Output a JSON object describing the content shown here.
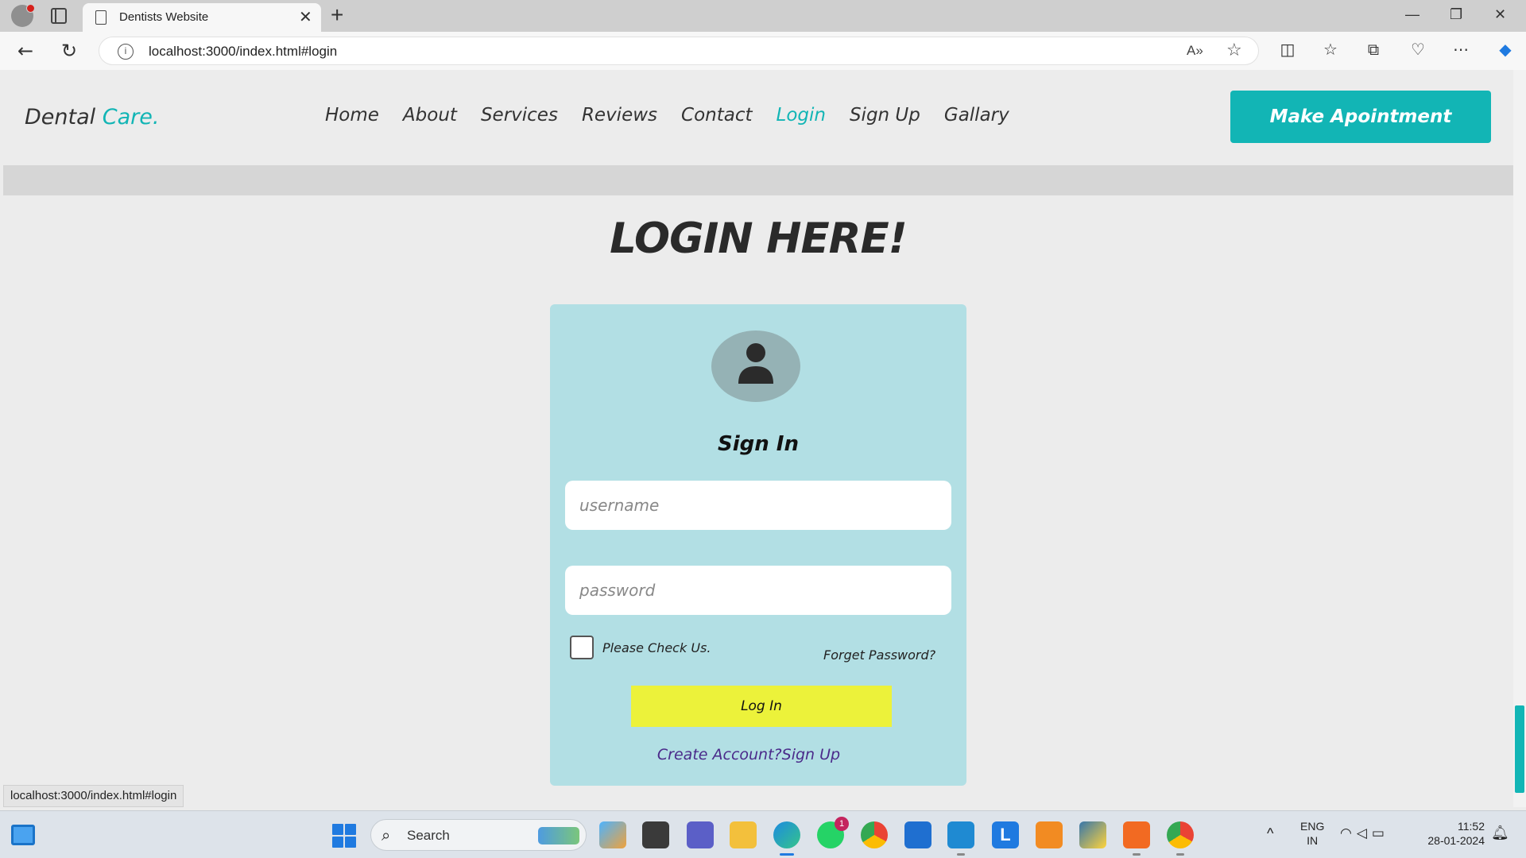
{
  "browser": {
    "tab_title": "Dentists Website",
    "tab_close": "✕",
    "new_tab": "+",
    "url": "localhost:3000/index.html#login",
    "window_controls": [
      "—",
      "❐",
      "✕"
    ],
    "status_url": "localhost:3000/index.html#login",
    "icons": [
      "back-icon",
      "refresh-icon",
      "info-icon",
      "read-aloud-icon",
      "favorite-icon",
      "split-screen-icon",
      "favorites-icon",
      "collections-icon",
      "browser-essentials-icon",
      "more-icon",
      "copilot-icon"
    ]
  },
  "site": {
    "logo": {
      "main": "Dental",
      "accent": "Care."
    },
    "nav": [
      {
        "label": "Home"
      },
      {
        "label": "About"
      },
      {
        "label": "Services"
      },
      {
        "label": "Reviews"
      },
      {
        "label": "Contact"
      },
      {
        "label": "Login",
        "active": true
      },
      {
        "label": "Sign Up"
      },
      {
        "label": "Gallary"
      }
    ],
    "cta_label": "Make Apointment",
    "accent_color": "#12b5b5"
  },
  "login": {
    "heading": "LOGIN HERE!",
    "title": "Sign In",
    "username_placeholder": "username",
    "password_placeholder": "password",
    "checkbox_label": "Please Check Us.",
    "forgot_label": "Forget Password?",
    "button_label": "Log In",
    "signup_text": "Create Account?Sign Up",
    "card_color": "#b2dfe4",
    "button_color": "#ecf23a"
  },
  "taskbar": {
    "search_label": "Search",
    "whatsapp_badge": "1",
    "lang_line1": "ENG",
    "lang_line2": "IN",
    "time": "11:52",
    "date": "28-01-2024",
    "apps": [
      "widgets-icon",
      "start-icon",
      "copilot-icon",
      "file-explorer-icon",
      "teams-icon",
      "folder-icon",
      "edge-icon",
      "whatsapp-icon",
      "chrome-icon",
      "store-icon",
      "vscode-icon",
      "l-app-icon",
      "sublime-icon",
      "python-icon",
      "xampp-icon",
      "chrome-dev-icon"
    ]
  }
}
